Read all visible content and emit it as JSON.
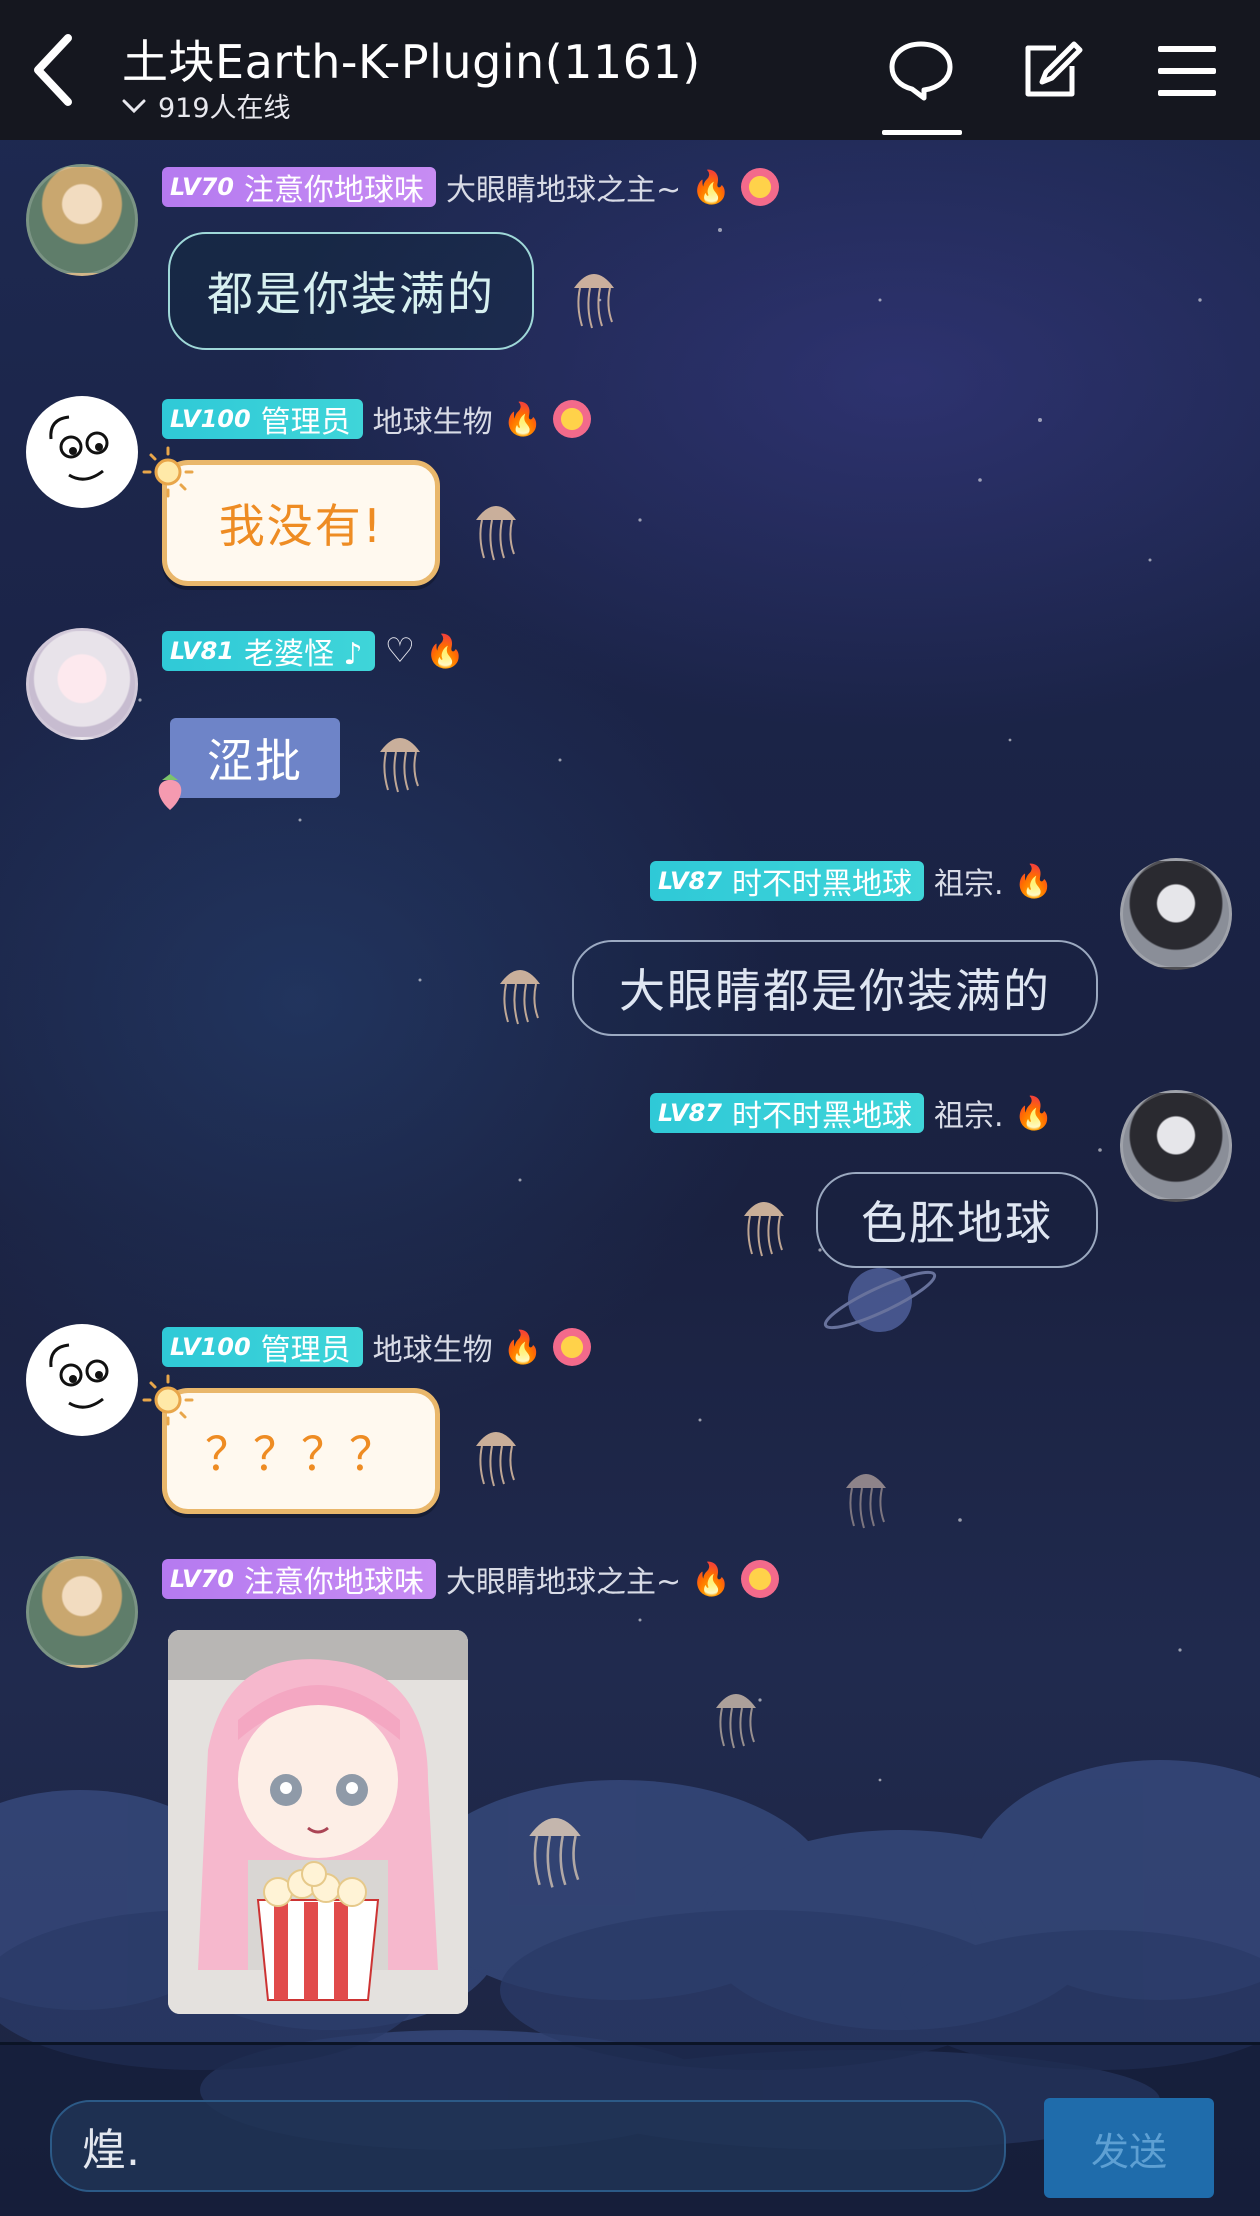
{
  "header": {
    "title": "土块Earth-K-Plugin(1161)",
    "online": "919人在线"
  },
  "messages": [
    {
      "level": "LV70",
      "badge": "注意你地球味",
      "name": "大眼睛地球之主~",
      "text": "都是你装满的"
    },
    {
      "level": "LV100",
      "badge": "管理员",
      "name": "地球生物",
      "text": "我没有!"
    },
    {
      "level": "LV81",
      "badge": "老婆怪 ♪",
      "heart": "♡",
      "text": "涩批"
    },
    {
      "level": "LV87",
      "badge": "时不时黑地球",
      "name": "祖宗.",
      "text": "大眼睛都是你装满的"
    },
    {
      "level": "LV87",
      "badge": "时不时黑地球",
      "name": "祖宗.",
      "text": "色胚地球"
    },
    {
      "level": "LV100",
      "badge": "管理员",
      "name": "地球生物",
      "text": "？？？？"
    },
    {
      "level": "LV70",
      "badge": "注意你地球味",
      "name": "大眼睛地球之主~"
    }
  ],
  "input": {
    "value": "煌."
  },
  "send_label": "发送",
  "icons": {
    "back": "chevron-left-icon",
    "chat": "chat-bubble-icon",
    "edit": "edit-icon",
    "menu": "menu-icon"
  }
}
